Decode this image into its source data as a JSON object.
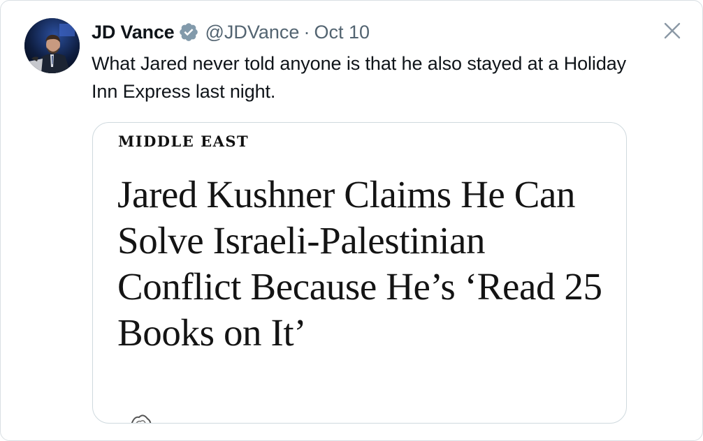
{
  "tweet": {
    "author": {
      "display_name": "JD Vance",
      "handle": "@JDVance",
      "verified": true,
      "avatar_icon": "person-portrait-avatar"
    },
    "separator": "·",
    "timestamp": "Oct 10",
    "text": "What Jared never told anyone is that he also stayed at a Holiday Inn Express last night.",
    "close_icon": "close-icon"
  },
  "embed": {
    "section": "MIDDLE EAST",
    "headline": "Jared Kushner Claims He Can Solve Israeli-Palestinian Conflict Because He’s ‘Read 25 Books on It’"
  },
  "colors": {
    "text_primary": "#0f1419",
    "text_secondary": "#536471",
    "verified_badge": "#829aab",
    "border": "#cfd9de"
  }
}
